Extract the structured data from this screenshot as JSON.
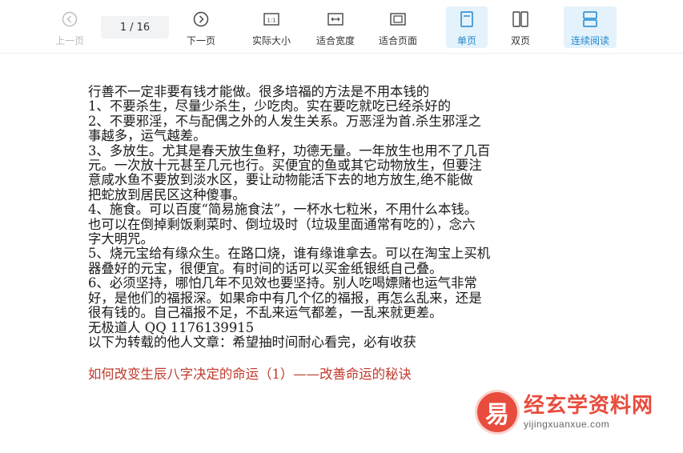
{
  "toolbar": {
    "prev": "上一页",
    "page_current": "1",
    "page_total": "16",
    "page_separator": "/",
    "next": "下一页",
    "actual_size": "实际大小",
    "fit_width": "适合宽度",
    "fit_page": "适合页面",
    "single_page": "单页",
    "double_page": "双页",
    "continuous": "连续阅读"
  },
  "colors": {
    "accent": "#1f88cf",
    "active_bg": "#e4f2fb",
    "title_red": "#c0392b",
    "watermark_red": "#e84c3d"
  },
  "document": {
    "lines": [
      "行善不一定非要有钱才能做。很多培福的方法是不用本钱的",
      "1、不要杀生，尽量少杀生，少吃肉。实在要吃就吃已经杀好的",
      "2、不要邪淫，不与配偶之外的人发生关系。万恶淫为首.杀生邪淫之",
      "事越多，运气越差。",
      "3、多放生。尤其是春天放生鱼籽，功德无量。一年放生也用不了几百",
      "元。一次放十元甚至几元也行。买便宜的鱼或其它动物放生，但要注",
      "意咸水鱼不要放到淡水区，要让动物能活下去的地方放生,绝不能做",
      "把蛇放到居民区这种傻事。",
      "4、施食。可以百度“简易施食法”，一杯水七粒米，不用什么本钱。",
      "也可以在倒掉剩饭剩菜时、倒垃圾时（垃圾里面通常有吃的），念六",
      "字大明咒。",
      "5、烧元宝给有缘众生。在路口烧，谁有缘谁拿去。可以在淘宝上买机",
      "器叠好的元宝，很便宜。有时间的话可以买金纸银纸自己叠。",
      "6、必须坚持，哪怕几年不见效也要坚持。别人吃喝嫖赌也运气非常",
      "好，是他们的福报深。如果命中有几个亿的福报，再怎么乱来，还是",
      "很有钱的。自己福报不足，不乱来运气都差，一乱来就更差。",
      "无极道人 QQ 1176139915",
      "以下为转载的他人文章：希望抽时间耐心看完，必有收获"
    ],
    "section_title": "如何改变生辰八字决定的命运（1）——改善命运的秘诀"
  },
  "watermark": {
    "logo_char": "易",
    "name": "经玄学资料网",
    "url": "yijingxuanxue.com"
  }
}
